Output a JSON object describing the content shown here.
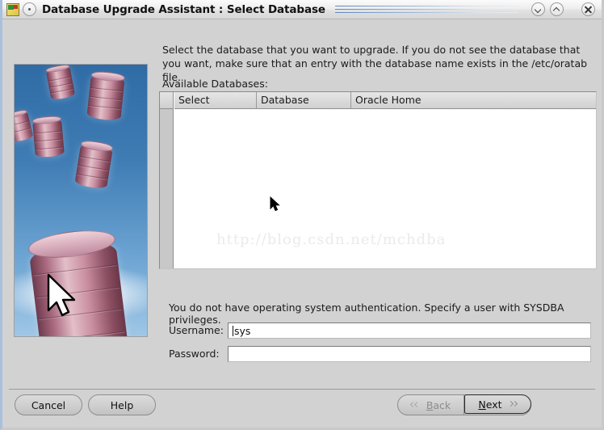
{
  "titlebar": {
    "title": "Database Upgrade Assistant : Select Database",
    "app_icon": "oracle-app-icon",
    "menu_icon": "window-menu-icon",
    "minimize_icon": "chevron-down-icon",
    "maximize_icon": "chevron-up-icon",
    "close_icon": "close-x-icon"
  },
  "sidebar": {
    "graphic_name": "database-cylinders-illustration",
    "cursor_icon": "arrow-pointer-graphic"
  },
  "main": {
    "instructions": "Select the database that you want to upgrade. If you do not see the database that you want, make sure that an entry with the database name exists in the /etc/oratab file.",
    "available_label": "Available Databases:",
    "table": {
      "columns": [
        "Select",
        "Database",
        "Oracle Home"
      ],
      "rows": [],
      "watermark": "http://blog.csdn.net/mchdba"
    },
    "auth_message": "You do not have operating system authentication. Specify a user with SYSDBA privileges.",
    "fields": [
      {
        "label": "Username:",
        "value": "sys",
        "placeholder": ""
      },
      {
        "label": "Password:",
        "value": "",
        "placeholder": ""
      }
    ]
  },
  "buttons": {
    "cancel": "Cancel",
    "help": "Help",
    "back": "Back",
    "back_mnemonic": "B",
    "back_rest": "ack",
    "next": "Next",
    "next_mnemonic": "N",
    "next_rest": "ext",
    "back_icon": "double-chevron-left-icon",
    "next_icon": "double-chevron-right-icon",
    "back_enabled": false,
    "next_focused": true
  },
  "colors": {
    "window_bg": "#d2d2d2",
    "titlebar_accent": "#5b88c4",
    "table_bg": "#ffffff",
    "border": "#8b8b8b",
    "sidebar_sky": "#3f7cb4",
    "cylinder": "#b3788c"
  }
}
